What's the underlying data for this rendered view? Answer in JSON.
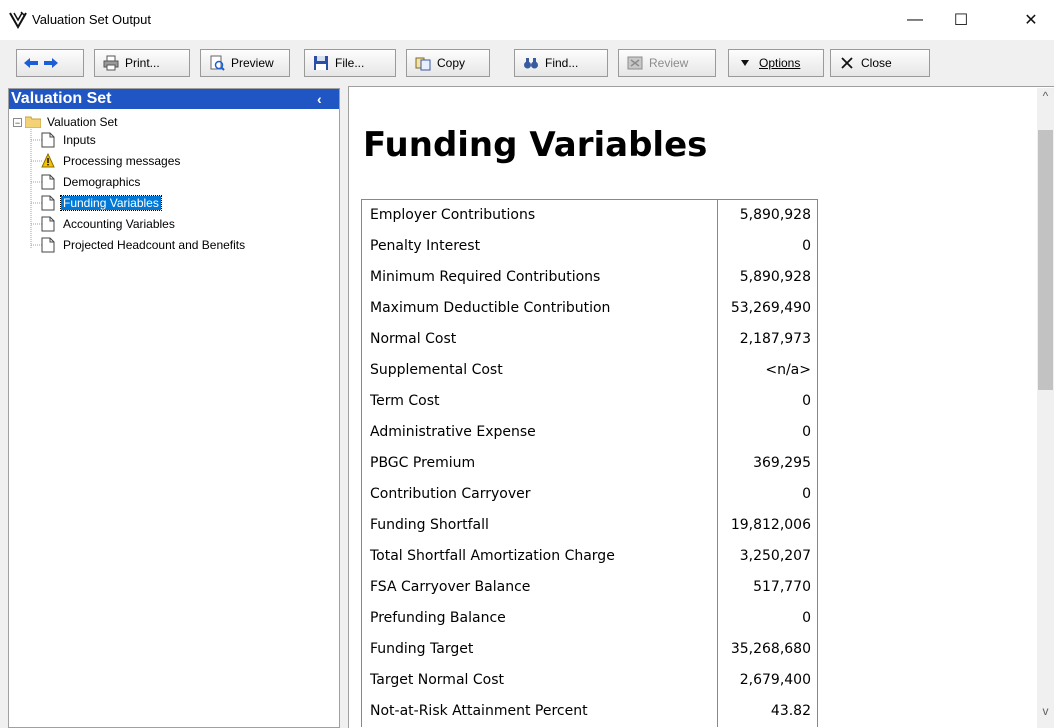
{
  "window": {
    "title": "Valuation Set Output",
    "icon": "valuation-logo-icon",
    "controls": {
      "minimize": "—",
      "maximize": "☐",
      "close": "✕"
    }
  },
  "toolbar": {
    "back_icon": "arrow-left-icon",
    "forward_icon": "arrow-right-icon",
    "print_label": "Print...",
    "preview_label": "Preview",
    "file_label": "File...",
    "copy_label": "Copy",
    "find_label": "Find...",
    "review_label": "Review",
    "options_label": "Options",
    "close_label": "Close"
  },
  "left_pane": {
    "header": "Valuation Set",
    "collapse_glyph": "‹",
    "root_label": "Valuation Set",
    "items": [
      {
        "label": "Inputs",
        "icon": "document-icon"
      },
      {
        "label": "Processing messages",
        "icon": "warning-icon"
      },
      {
        "label": "Demographics",
        "icon": "document-icon"
      },
      {
        "label": "Funding Variables",
        "icon": "document-icon",
        "selected": true
      },
      {
        "label": "Accounting Variables",
        "icon": "document-icon"
      },
      {
        "label": "Projected Headcount and Benefits",
        "icon": "document-icon"
      }
    ]
  },
  "main": {
    "title": "Funding Variables",
    "rows": [
      {
        "label": "Employer Contributions",
        "value": "5,890,928"
      },
      {
        "label": "Penalty Interest",
        "value": "0"
      },
      {
        "label": "Minimum Required Contributions",
        "value": "5,890,928"
      },
      {
        "label": "Maximum Deductible Contribution",
        "value": "53,269,490"
      },
      {
        "label": "Normal Cost",
        "value": "2,187,973"
      },
      {
        "label": "Supplemental Cost",
        "value": "<n/a>"
      },
      {
        "label": "Term Cost",
        "value": "0"
      },
      {
        "label": "Administrative Expense",
        "value": "0"
      },
      {
        "label": "PBGC Premium",
        "value": "369,295"
      },
      {
        "label": "Contribution Carryover",
        "value": "0"
      },
      {
        "label": "Funding Shortfall",
        "value": "19,812,006"
      },
      {
        "label": "Total Shortfall Amortization Charge",
        "value": "3,250,207"
      },
      {
        "label": "FSA Carryover Balance",
        "value": "517,770"
      },
      {
        "label": "Prefunding Balance",
        "value": "0"
      },
      {
        "label": "Funding Target",
        "value": "35,268,680"
      },
      {
        "label": "Target Normal Cost",
        "value": "2,679,400"
      },
      {
        "label": "Not-at-Risk Attainment Percent",
        "value": "43.82"
      }
    ]
  },
  "scrollbar": {
    "up_glyph": "^",
    "down_glyph": "v"
  },
  "colors": {
    "selection": "#0078d7",
    "pane_header": "#1f56c4"
  }
}
